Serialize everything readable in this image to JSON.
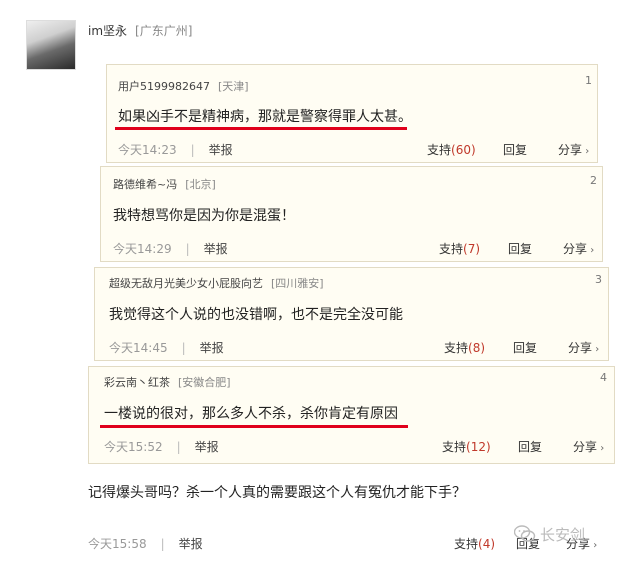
{
  "post": {
    "username": "im坚永",
    "location": "[广东广州]",
    "text": "记得爆头哥吗？杀一个人真的需要跟这个人有冤仇才能下手？",
    "time": "今天15:58",
    "report": "举报",
    "support_label": "支持",
    "support_count": "(4)",
    "reply": "回复",
    "share": "分享"
  },
  "comments": [
    {
      "user": "用户5199982647",
      "location": "[天津]",
      "index": "1",
      "text": "如果凶手不是精神病，那就是警察得罪人太甚。",
      "time": "今天14:23",
      "report": "举报",
      "support_label": "支持",
      "support_count": "(60)",
      "reply": "回复",
      "share": "分享"
    },
    {
      "user": "路德维希~冯",
      "location": "[北京]",
      "index": "2",
      "text": "我特想骂你是因为你是混蛋！",
      "time": "今天14:29",
      "report": "举报",
      "support_label": "支持",
      "support_count": "(7)",
      "reply": "回复",
      "share": "分享"
    },
    {
      "user": "超级无敌月光美少女小屁股向艺",
      "location": "[四川雅安]",
      "index": "3",
      "text": "我觉得这个人说的也没错啊，也不是完全没可能",
      "time": "今天14:45",
      "report": "举报",
      "support_label": "支持",
      "support_count": "(8)",
      "reply": "回复",
      "share": "分享"
    },
    {
      "user": "彩云南丶红茶",
      "location": "[安徽合肥]",
      "index": "4",
      "text": "一楼说的很对，那么多人不杀，杀你肯定有原因",
      "time": "今天15:52",
      "report": "举报",
      "support_label": "支持",
      "support_count": "(12)",
      "reply": "回复",
      "share": "分享"
    }
  ],
  "watermark": "长安剑",
  "colors": {
    "highlight_line": "#e0001b",
    "support_count": "#c0392b"
  },
  "icons": {
    "share_arrow": "chevron-right-icon",
    "watermark_logo": "wechat-icon"
  }
}
